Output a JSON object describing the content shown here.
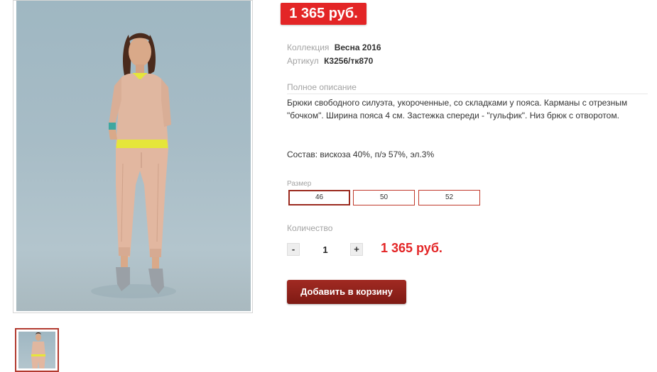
{
  "product": {
    "price_badge": "1 365 руб.",
    "collection_label": "Коллекция",
    "collection_value": "Весна 2016",
    "article_label": "Артикул",
    "article_value": "К3256/тк870",
    "description_title": "Полное описание",
    "description": "Брюки свободного силуэта, укороченные, со складками у пояса. Карманы с отрезным \"бочком\". Ширина пояса 4 см. Застежка спереди - \"гульфик\". Низ брюк с отворотом.",
    "composition": "Состав: вискоза 40%, п/э 57%, эл.3%"
  },
  "size": {
    "label": "Размер",
    "options": [
      "46",
      "50",
      "52"
    ],
    "selected": "46"
  },
  "quantity": {
    "label": "Количество",
    "minus": "-",
    "value": "1",
    "plus": "+"
  },
  "total_price": "1 365 руб.",
  "cart": {
    "add_label": "Добавить в корзину"
  },
  "colors": {
    "price_red": "#e32526",
    "button_dark_red": "#8c2119",
    "size_border": "#c0392b"
  }
}
